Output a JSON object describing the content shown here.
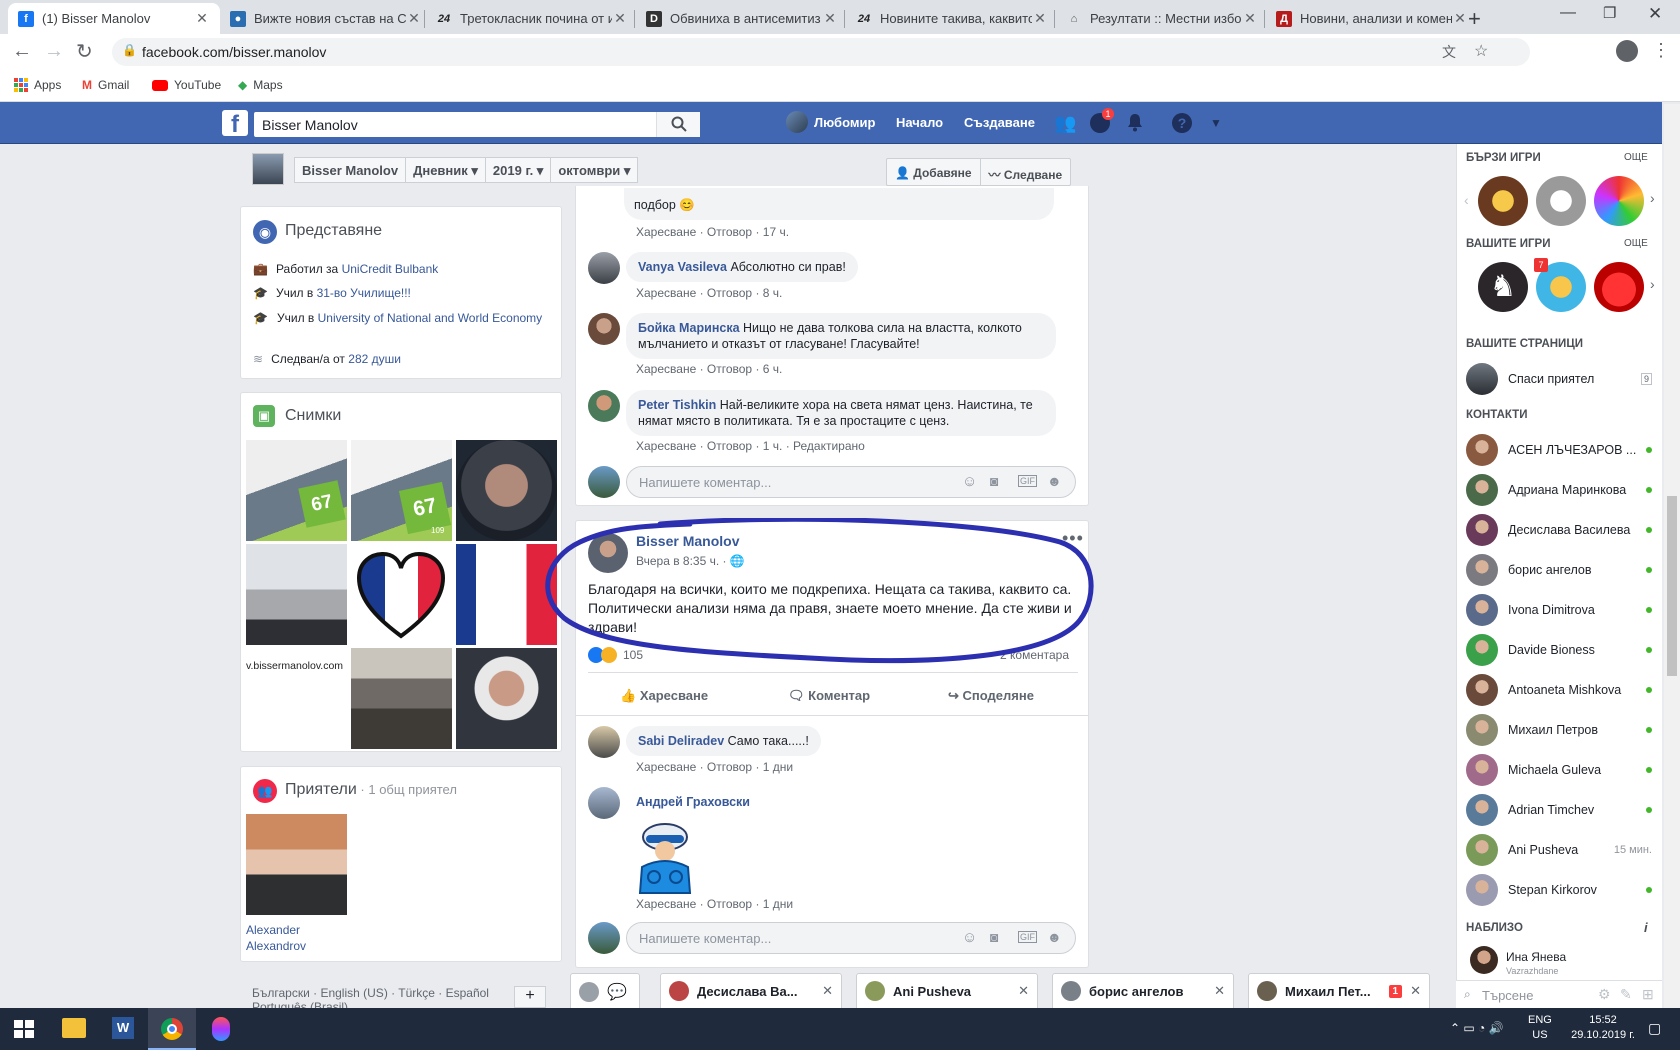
{
  "browser": {
    "tabs": [
      {
        "title": "(1) Bisser Manolov",
        "active": true
      },
      {
        "title": "Вижте новия състав на Ст"
      },
      {
        "title": "Третокласник почина от и"
      },
      {
        "title": "Обвиниха в антисемитиз"
      },
      {
        "title": "Новините такива, каквито"
      },
      {
        "title": "Резултати :: Местни избор"
      },
      {
        "title": "Новини, анализи и комен"
      }
    ],
    "url": "facebook.com/bisser.manolov",
    "bookmarks": [
      "Apps",
      "Gmail",
      "YouTube",
      "Maps"
    ]
  },
  "fb_header": {
    "search_value": "Bisser Manolov",
    "user_name": "Любомир",
    "home": "Начало",
    "create": "Създаване",
    "messenger_badge": "1"
  },
  "profile_bar": {
    "name": "Bisser Manolov",
    "timeline": "Дневник",
    "year": "2019 г.",
    "month": "октомври",
    "add_friend": "Добавяне",
    "follow": "Следване"
  },
  "intro": {
    "title": "Представяне",
    "worked_prefix": "Работил за ",
    "worked_link": "UniCredit Bulbank",
    "studied1_prefix": "Учил в ",
    "studied1_link": "31-во Училище!!!",
    "studied2_prefix": "Учил в ",
    "studied2_link": "University of National and World Economy",
    "followed_prefix": "Следван/а от ",
    "followed_link": "282 души"
  },
  "photos": {
    "title": "Снимки",
    "website_caption": "v.bissermanolov.com",
    "badge_number": "67",
    "badge_small": "109"
  },
  "friends": {
    "title": "Приятели",
    "mutual": " · 1 общ приятел",
    "friend_first": "Alexander",
    "friend_last": "Alexandrov"
  },
  "footer_langs": "Български · English (US) · Türkçe · Español",
  "footer_langs2": "Português (Brasil)",
  "post1_comments": [
    {
      "name": "",
      "text": "подбор 😊",
      "meta": "Харесване · Отговор · 17 ч."
    },
    {
      "name": "Vanya Vasileva",
      "text": "Абсолютно си прав!",
      "meta": "Харесване · Отговор · 8 ч."
    },
    {
      "name": "Бойка Маринска",
      "text": "Нищо не дава толкова сила на властта, колкото мълчанието и отказът от гласуване! Гласувайте!",
      "meta": "Харесване · Отговор · 6 ч."
    },
    {
      "name": "Peter Tishkin",
      "text": "Най-великите хора на света нямат ценз. Наистина, те нямат място в политиката. Тя е за простаците с ценз.",
      "meta": "Харесване · Отговор · 1 ч. · Редактирано"
    }
  ],
  "comment_placeholder": "Напишете коментар...",
  "post2": {
    "author": "Bisser Manolov",
    "time": "Вчера в 8:35 ч. ·",
    "text": "Благодаря на всички, които ме подкрепиха. Нещата са такива, каквито са. Политически анализи няма да правя, знаете моето мнение. Да сте живи и здрави!",
    "reactions": "105",
    "comments_count": "2 коментара",
    "like": "Харесване",
    "comment": "Коментар",
    "share": "Споделяне"
  },
  "post2_comments": [
    {
      "name": "Sabi Deliradev",
      "text": "Само така.....!",
      "meta": "Харесване · Отговор · 1 дни"
    },
    {
      "name": "Андрей Граховски",
      "text": "",
      "meta": "Харесване · Отговор · 1 дни"
    }
  ],
  "right": {
    "quick_games": "БЪРЗИ ИГРИ",
    "your_games": "ВАШИТЕ ИГРИ",
    "more": "ОЩЕ",
    "your_pages": "ВАШИТЕ СТРАНИЦИ",
    "page_name": "Спаси приятел",
    "page_badge": "9",
    "contacts_title": "КОНТАКТИ",
    "contacts": [
      {
        "name": "АСЕН ЛЪЧЕЗАРОВ ...",
        "status": "online"
      },
      {
        "name": "Адриана Маринкова",
        "status": "online"
      },
      {
        "name": "Десислава Василева",
        "status": "online"
      },
      {
        "name": "борис ангелов",
        "status": "online"
      },
      {
        "name": "Ivona Dimitrova",
        "status": "online"
      },
      {
        "name": "Davide Bioness",
        "status": "online"
      },
      {
        "name": "Antoaneta Mishkova",
        "status": "online"
      },
      {
        "name": "Михаил Петров",
        "status": "online"
      },
      {
        "name": "Michaela Guleva",
        "status": "online"
      },
      {
        "name": "Adrian Timchev",
        "status": "online"
      },
      {
        "name": "Ani Pusheva",
        "status": "15 мин."
      },
      {
        "name": "Stepan Kirkorov",
        "status": "online"
      }
    ],
    "nearby": "НАБЛИЗО",
    "nearby_name": "Ина Янева",
    "nearby_sub": "Vazrazhdane",
    "search_placeholder": "Търсене"
  },
  "chat_tabs": [
    {
      "name": "Десислава Ва..."
    },
    {
      "name": "Ani Pusheva"
    },
    {
      "name": "борис ангелов"
    },
    {
      "name": "Михаил Пет...",
      "badge": "1"
    }
  ],
  "taskbar": {
    "lang1": "ENG",
    "lang2": "US",
    "time": "15:52",
    "date": "29.10.2019 г."
  },
  "colors": {
    "fb_blue": "#4267b2",
    "link": "#385898",
    "annotation": "#2b2fb0",
    "online": "#42b72a"
  }
}
